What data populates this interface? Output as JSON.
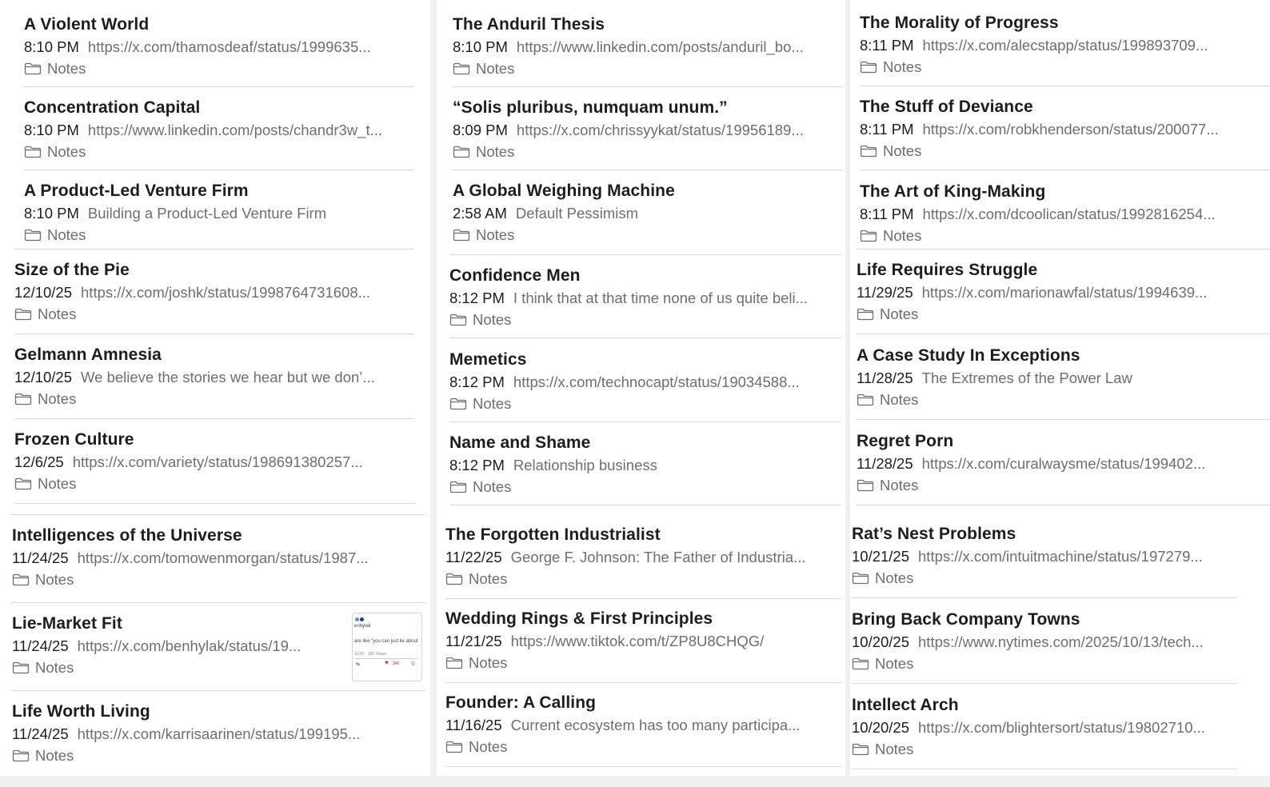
{
  "columns": [
    {
      "notes": [
        {
          "title": "A Violent World",
          "time": "8:10 PM",
          "preview": "https://x.com/thamosdeaf/status/1999635...",
          "folder": "Notes"
        },
        {
          "title": "Concentration Capital",
          "time": "8:10 PM",
          "preview": "https://www.linkedin.com/posts/chandr3w_t...",
          "folder": "Notes"
        },
        {
          "title": "A Product-Led Venture Firm",
          "time": "8:10 PM",
          "preview": "Building a Product-Led Venture Firm",
          "folder": "Notes"
        },
        {
          "title": "Size of the Pie",
          "time": "12/10/25",
          "preview": "https://x.com/joshk/status/1998764731608...",
          "folder": "Notes"
        },
        {
          "title": "Gelmann Amnesia",
          "time": "12/10/25",
          "preview": "We believe the stories we hear but we don’...",
          "folder": "Notes"
        },
        {
          "title": "Frozen Culture",
          "time": "12/6/25",
          "preview": "https://x.com/variety/status/198691380257...",
          "folder": "Notes"
        },
        {
          "title": "Intelligences of the Universe",
          "time": "11/24/25",
          "preview": "https://x.com/tomowenmorgan/status/1987...",
          "folder": "Notes"
        },
        {
          "title": "Lie-Market Fit",
          "time": "11/24/25",
          "preview": "https://x.com/benhylak/status/19...",
          "folder": "Notes"
        },
        {
          "title": "Life Worth Living",
          "time": "11/24/25",
          "preview": "https://x.com/karrisaarinen/status/199195...",
          "folder": "Notes"
        }
      ]
    },
    {
      "notes": [
        {
          "title": "The Anduril Thesis",
          "time": "8:10 PM",
          "preview": "https://www.linkedin.com/posts/anduril_bo...",
          "folder": "Notes"
        },
        {
          "title": "“Solis pluribus, numquam unum.”",
          "time": "8:09 PM",
          "preview": "https://x.com/chrissyykat/status/19956189...",
          "folder": "Notes"
        },
        {
          "title": "A Global Weighing Machine",
          "time": "2:58 AM",
          "preview": "Default Pessimism",
          "folder": "Notes"
        },
        {
          "title": "Confidence Men",
          "time": "8:12 PM",
          "preview": "I think that at that time none of us quite beli...",
          "folder": "Notes"
        },
        {
          "title": "Memetics",
          "time": "8:12 PM",
          "preview": "https://x.com/technocapt/status/19034588...",
          "folder": "Notes"
        },
        {
          "title": "Name and Shame",
          "time": "8:12 PM",
          "preview": "Relationship business",
          "folder": "Notes"
        },
        {
          "title": "The Forgotten Industrialist",
          "time": "11/22/25",
          "preview": "George F. Johnson: The Father of Industria...",
          "folder": "Notes"
        },
        {
          "title": "Wedding Rings & First Principles",
          "time": "11/21/25",
          "preview": "https://www.tiktok.com/t/ZP8U8CHQG/",
          "folder": "Notes"
        },
        {
          "title": "Founder: A Calling",
          "time": "11/16/25",
          "preview": "Current ecosystem has too many participa...",
          "folder": "Notes"
        }
      ]
    },
    {
      "notes": [
        {
          "title": "The Morality of Progress",
          "time": "8:11 PM",
          "preview": "https://x.com/alecstapp/status/199893709...",
          "folder": "Notes"
        },
        {
          "title": "The Stuff of Deviance",
          "time": "8:11 PM",
          "preview": "https://x.com/robkhenderson/status/200077...",
          "folder": "Notes"
        },
        {
          "title": "The Art of King-Making",
          "time": "8:11 PM",
          "preview": "https://x.com/dcoolican/status/1992816254...",
          "folder": "Notes"
        },
        {
          "title": "Life Requires Struggle",
          "time": "11/29/25",
          "preview": "https://x.com/marionawfal/status/1994639...",
          "folder": "Notes"
        },
        {
          "title": "A Case Study In Exceptions",
          "time": "11/28/25",
          "preview": "The Extremes of the Power Law",
          "folder": "Notes"
        },
        {
          "title": "Regret Porn",
          "time": "11/28/25",
          "preview": "https://x.com/curalwaysme/status/199402...",
          "folder": "Notes"
        },
        {
          "title": "Rat’s Nest Problems",
          "time": "10/21/25",
          "preview": "https://x.com/intuitmachine/status/197279...",
          "folder": "Notes"
        },
        {
          "title": "Bring Back Company Towns",
          "time": "10/20/25",
          "preview": "https://www.nytimes.com/2025/10/13/tech...",
          "folder": "Notes"
        },
        {
          "title": "Intellect Arch",
          "time": "10/20/25",
          "preview": "https://x.com/blightersort/status/19802710...",
          "folder": "Notes"
        }
      ]
    }
  ],
  "thumbnail": {
    "handle": "enhylak",
    "snippet": "are like \"you can just lie about",
    "views": "11/25 · 15K Views",
    "likes": "346"
  },
  "colors": {
    "title": "#1d1d1f",
    "secondary": "#6e6e73",
    "divider": "#d9d9d9",
    "background": "#f0f0f0"
  }
}
